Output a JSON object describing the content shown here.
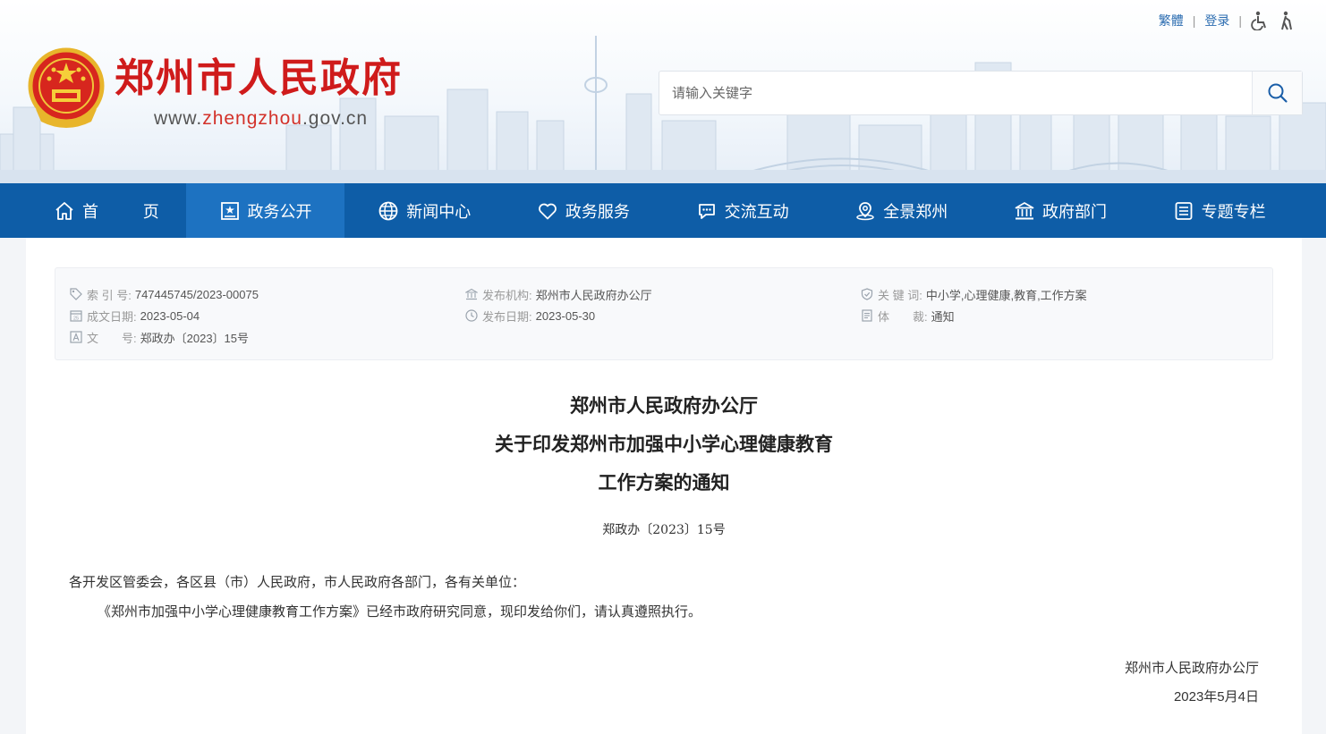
{
  "header": {
    "site_title": "郑州市人民政府",
    "site_url_prefix": "www.",
    "site_url_highlight": "zhengzhou",
    "site_url_suffix": ".gov.cn",
    "emblem_icon": "national-emblem-icon",
    "top_links": {
      "traditional": "繁體",
      "login": "登录"
    },
    "accessibility_icons": [
      "wheelchair-icon",
      "elderly-icon"
    ],
    "search": {
      "placeholder": "请输入关键字",
      "value": "",
      "icon": "search-icon"
    }
  },
  "nav": {
    "items": [
      {
        "label": "首 页",
        "icon": "home-icon",
        "active": false
      },
      {
        "label": "政务公开",
        "icon": "bulletin-icon",
        "active": true
      },
      {
        "label": "新闻中心",
        "icon": "globe-icon",
        "active": false
      },
      {
        "label": "政务服务",
        "icon": "heart-icon",
        "active": false
      },
      {
        "label": "交流互动",
        "icon": "chat-icon",
        "active": false
      },
      {
        "label": "全景郑州",
        "icon": "panorama-icon",
        "active": false
      },
      {
        "label": "政府部门",
        "icon": "building-icon",
        "active": false
      },
      {
        "label": "专题专栏",
        "icon": "list-icon",
        "active": false
      }
    ]
  },
  "meta": {
    "index_no": {
      "key": "索 引 号:",
      "value": "747445745/2023-00075"
    },
    "created": {
      "key": "成文日期:",
      "value": "2023-05-04"
    },
    "doc_no": {
      "key": "文　　号:",
      "value": "郑政办〔2023〕15号"
    },
    "issuer": {
      "key": "发布机构:",
      "value": "郑州市人民政府办公厅"
    },
    "published": {
      "key": "发布日期:",
      "value": "2023-05-30"
    },
    "keywords": {
      "key": "关 键 词:",
      "value": "中小学,心理健康,教育,工作方案"
    },
    "genre": {
      "key": "体　　裁:",
      "value": "通知"
    }
  },
  "document": {
    "title_lines": [
      "郑州市人民政府办公厅",
      "关于印发郑州市加强中小学心理健康教育",
      "工作方案的通知"
    ],
    "number": "郑政办〔2023〕15号",
    "recipients": "各开发区管委会，各区县（市）人民政府，市人民政府各部门，各有关单位：",
    "body": "《郑州市加强中小学心理健康教育工作方案》已经市政府研究同意，现印发给你们，请认真遵照执行。",
    "signature": "郑州市人民政府办公厅",
    "date": "2023年5月4日"
  },
  "colors": {
    "nav_bg": "#0e5da7",
    "nav_active": "#1d72c1",
    "title_red": "#cf1b1b",
    "link_blue": "#2b6cb0"
  }
}
